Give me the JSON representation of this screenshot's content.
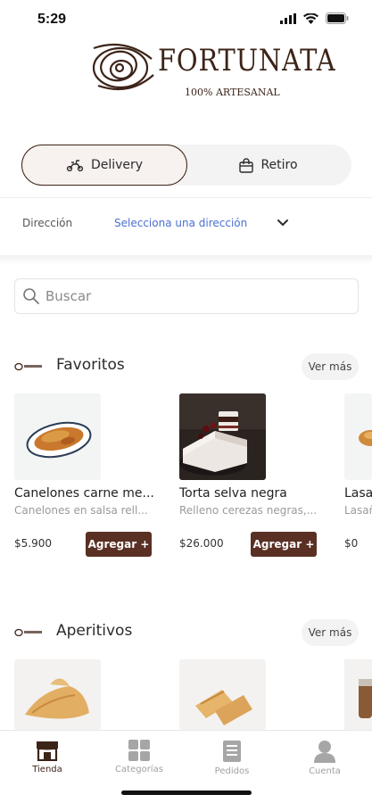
{
  "status": {
    "time": "5:29"
  },
  "brand": {
    "name": "FORTUNATA",
    "tagline": "100% ARTESANAL"
  },
  "toggle": {
    "delivery_label": "Delivery",
    "pickup_label": "Retiro",
    "selected": "Delivery"
  },
  "address": {
    "label": "Dirección",
    "value": "Selecciona una dirección"
  },
  "search": {
    "placeholder": "Buscar"
  },
  "sections": [
    {
      "title": "Favoritos",
      "see_more": "Ver más",
      "products": [
        {
          "name": "Canelones carne me...",
          "description": "Canelones en salsa rell...",
          "price": "$5.900",
          "button": "Agregar +"
        },
        {
          "name": "Torta selva negra",
          "description": "Relleno cerezas negras,...",
          "price": "$26.000",
          "button": "Agregar +"
        },
        {
          "name": "Lasa",
          "description": "Lasañ",
          "price": "$0"
        }
      ]
    },
    {
      "title": "Aperitivos",
      "see_more": "Ver más"
    }
  ],
  "tabbar": {
    "items": [
      {
        "label": "Tienda",
        "icon": "store-icon",
        "active": true
      },
      {
        "label": "Categorías",
        "icon": "grid-icon",
        "active": false
      },
      {
        "label": "Pedidos",
        "icon": "orders-icon",
        "active": false
      },
      {
        "label": "Cuenta",
        "icon": "user-icon",
        "active": false
      }
    ]
  },
  "colors": {
    "accent": "#5a3024",
    "brand_text": "#3d2418",
    "link": "#4a6fd0"
  }
}
